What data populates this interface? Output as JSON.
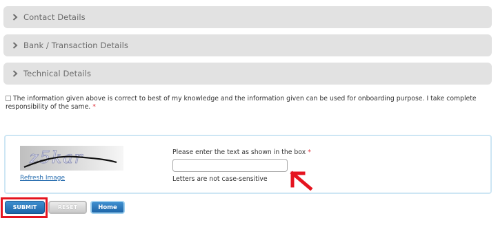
{
  "sections": [
    {
      "label": "Contact Details"
    },
    {
      "label": "Bank / Transaction Details"
    },
    {
      "label": "Technical Details"
    }
  ],
  "declaration": {
    "text": "The information given above is correct to best of my knowledge and the information given can be used for onboarding purpose. I take complete responsibility of the same.",
    "required_mark": "*",
    "checked": false
  },
  "captcha": {
    "image_text": "z5kar",
    "refresh_label": "Refresh Image",
    "prompt": "Please enter the text as shown in the box",
    "required_mark": "*",
    "input_value": "",
    "hint": "Letters are not case-sensitive"
  },
  "buttons": {
    "submit": "SUBMIT",
    "reset": "RESET",
    "home": "Home"
  },
  "icons": {
    "section_toggle": "chevron-right-icon",
    "annotation_arrow": "arrow-up-left-icon"
  },
  "colors": {
    "section_bg": "#e2e2e2",
    "primary_button": "#1d65a8",
    "required": "#e0303a",
    "annotation": "#e5141f"
  }
}
